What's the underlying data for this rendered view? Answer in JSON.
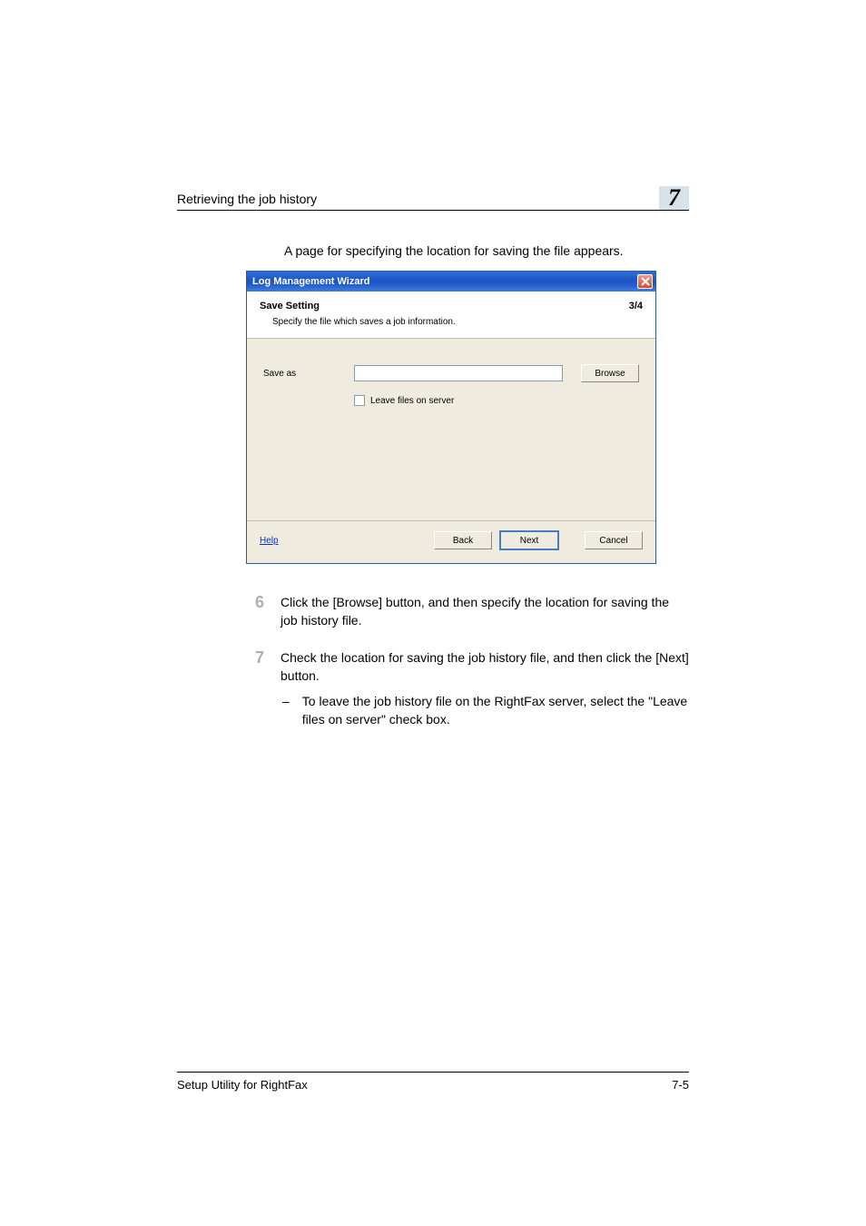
{
  "header": {
    "title": "Retrieving the job history",
    "chapter": "7"
  },
  "intro": "A page for specifying the location for saving the file appears.",
  "dialog": {
    "title": "Log Management Wizard",
    "section_title": "Save Setting",
    "section_subtitle": "Specify the file which saves a job information.",
    "page_indicator": "3/4",
    "saveas_label": "Save as",
    "saveas_value": "",
    "browse_label": "Browse",
    "checkbox_label": "Leave files on server",
    "help_label": "Help",
    "back_label": "Back",
    "next_label": "Next",
    "cancel_label": "Cancel"
  },
  "steps": [
    {
      "num": "6",
      "text": "Click the [Browse] button, and then specify the location for saving the job history file."
    },
    {
      "num": "7",
      "text": "Check the location for saving the job history file, and then click the [Next] button.",
      "sub": "To leave the job history file on the RightFax server, select the \"Leave files on server\" check box."
    }
  ],
  "footer": {
    "left": "Setup Utility for RightFax",
    "right": "7-5"
  }
}
